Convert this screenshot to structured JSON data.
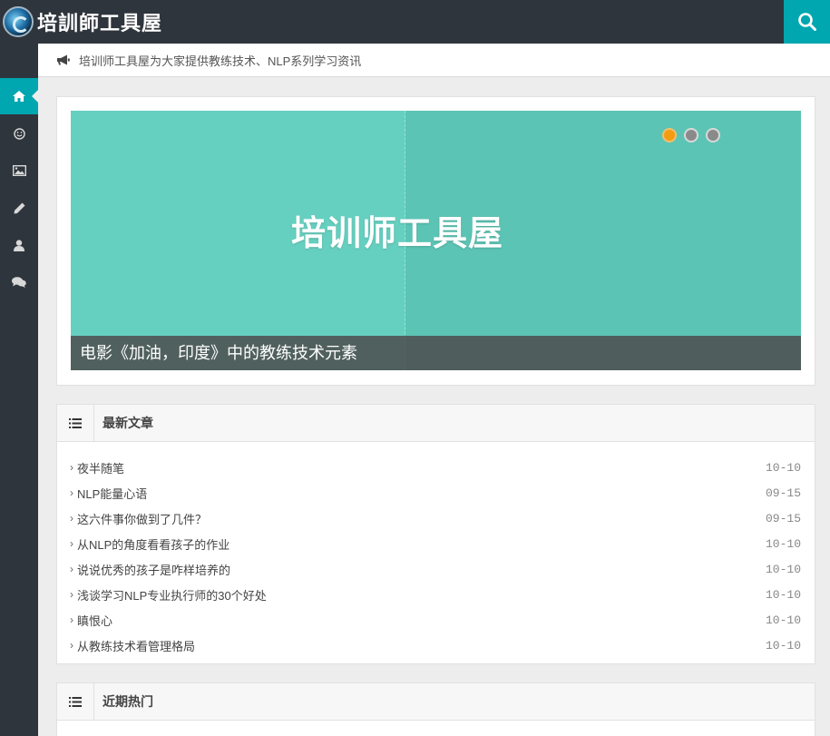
{
  "header": {
    "logo_text": "培訓師工具屋",
    "search_icon": "search-icon"
  },
  "sidebar": {
    "items": [
      {
        "name": "home",
        "icon": "home-icon",
        "active": true
      },
      {
        "name": "smile",
        "icon": "smile-icon",
        "active": false
      },
      {
        "name": "image",
        "icon": "image-icon",
        "active": false
      },
      {
        "name": "pencil",
        "icon": "pencil-icon",
        "active": false
      },
      {
        "name": "user",
        "icon": "user-icon",
        "active": false
      },
      {
        "name": "comments",
        "icon": "comments-icon",
        "active": false
      }
    ]
  },
  "notice": {
    "icon": "bullhorn-icon",
    "text": "培训师工具屋为大家提供教练技术、NLP系列学习资讯"
  },
  "slider": {
    "banner_title": "培训师工具屋",
    "caption": "电影《加油，印度》中的教练技术元素",
    "dots": 3,
    "active_dot": 0
  },
  "latest": {
    "title": "最新文章",
    "icon": "list-icon",
    "items": [
      {
        "title": "夜半随笔",
        "date": "10-10"
      },
      {
        "title": "NLP能量心语",
        "date": "09-15"
      },
      {
        "title": "这六件事你做到了几件？",
        "date": "09-15"
      },
      {
        "title": "从NLP的角度看看孩子的作业",
        "date": "10-10"
      },
      {
        "title": "说说优秀的孩子是咋样培养的",
        "date": "10-10"
      },
      {
        "title": "浅谈学习NLP专业执行师的30个好处",
        "date": "10-10"
      },
      {
        "title": "瞋恨心",
        "date": "10-10"
      },
      {
        "title": "从教练技术看管理格局",
        "date": "10-10"
      }
    ]
  },
  "hot": {
    "title": "近期热门",
    "icon": "list-icon"
  },
  "colors": {
    "accent": "#00a6b0",
    "dark": "#2f353c",
    "dot_active": "#f39c12",
    "banner": "#5cc4b4"
  }
}
